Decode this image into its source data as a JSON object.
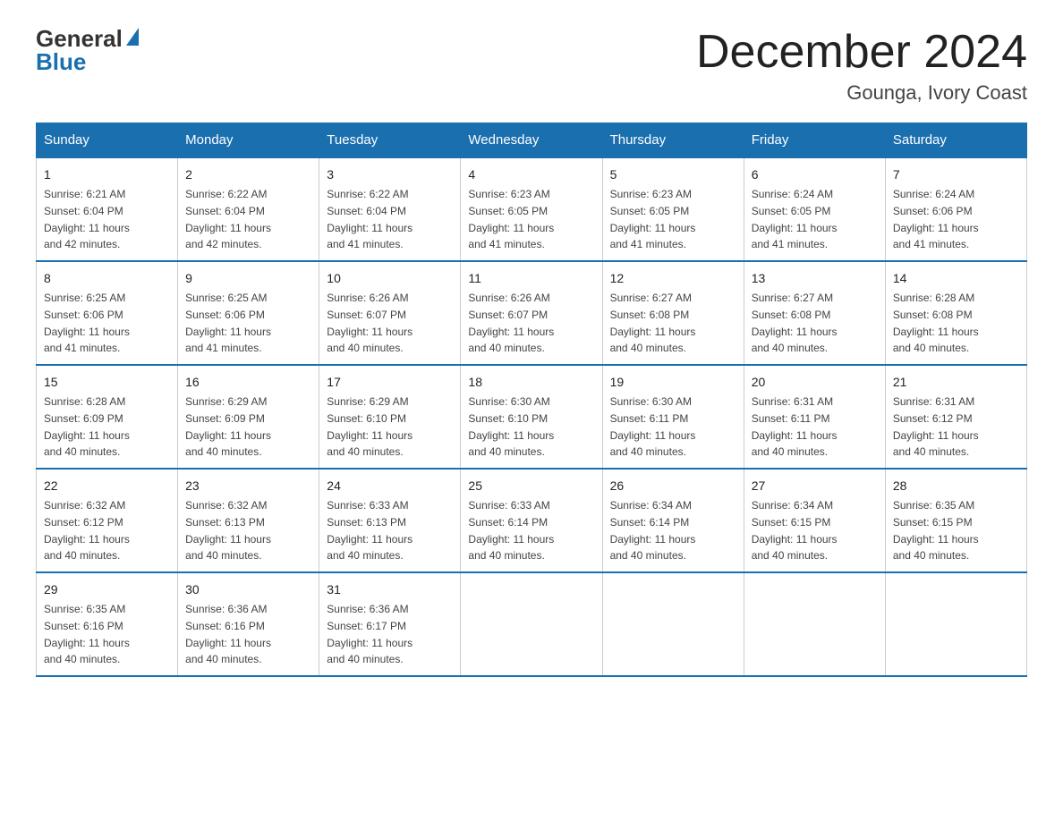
{
  "header": {
    "logo_general": "General",
    "logo_blue": "Blue",
    "month_title": "December 2024",
    "location": "Gounga, Ivory Coast"
  },
  "days_of_week": [
    "Sunday",
    "Monday",
    "Tuesday",
    "Wednesday",
    "Thursday",
    "Friday",
    "Saturday"
  ],
  "weeks": [
    [
      {
        "day": "1",
        "sunrise": "6:21 AM",
        "sunset": "6:04 PM",
        "daylight": "11 hours and 42 minutes."
      },
      {
        "day": "2",
        "sunrise": "6:22 AM",
        "sunset": "6:04 PM",
        "daylight": "11 hours and 42 minutes."
      },
      {
        "day": "3",
        "sunrise": "6:22 AM",
        "sunset": "6:04 PM",
        "daylight": "11 hours and 41 minutes."
      },
      {
        "day": "4",
        "sunrise": "6:23 AM",
        "sunset": "6:05 PM",
        "daylight": "11 hours and 41 minutes."
      },
      {
        "day": "5",
        "sunrise": "6:23 AM",
        "sunset": "6:05 PM",
        "daylight": "11 hours and 41 minutes."
      },
      {
        "day": "6",
        "sunrise": "6:24 AM",
        "sunset": "6:05 PM",
        "daylight": "11 hours and 41 minutes."
      },
      {
        "day": "7",
        "sunrise": "6:24 AM",
        "sunset": "6:06 PM",
        "daylight": "11 hours and 41 minutes."
      }
    ],
    [
      {
        "day": "8",
        "sunrise": "6:25 AM",
        "sunset": "6:06 PM",
        "daylight": "11 hours and 41 minutes."
      },
      {
        "day": "9",
        "sunrise": "6:25 AM",
        "sunset": "6:06 PM",
        "daylight": "11 hours and 41 minutes."
      },
      {
        "day": "10",
        "sunrise": "6:26 AM",
        "sunset": "6:07 PM",
        "daylight": "11 hours and 40 minutes."
      },
      {
        "day": "11",
        "sunrise": "6:26 AM",
        "sunset": "6:07 PM",
        "daylight": "11 hours and 40 minutes."
      },
      {
        "day": "12",
        "sunrise": "6:27 AM",
        "sunset": "6:08 PM",
        "daylight": "11 hours and 40 minutes."
      },
      {
        "day": "13",
        "sunrise": "6:27 AM",
        "sunset": "6:08 PM",
        "daylight": "11 hours and 40 minutes."
      },
      {
        "day": "14",
        "sunrise": "6:28 AM",
        "sunset": "6:08 PM",
        "daylight": "11 hours and 40 minutes."
      }
    ],
    [
      {
        "day": "15",
        "sunrise": "6:28 AM",
        "sunset": "6:09 PM",
        "daylight": "11 hours and 40 minutes."
      },
      {
        "day": "16",
        "sunrise": "6:29 AM",
        "sunset": "6:09 PM",
        "daylight": "11 hours and 40 minutes."
      },
      {
        "day": "17",
        "sunrise": "6:29 AM",
        "sunset": "6:10 PM",
        "daylight": "11 hours and 40 minutes."
      },
      {
        "day": "18",
        "sunrise": "6:30 AM",
        "sunset": "6:10 PM",
        "daylight": "11 hours and 40 minutes."
      },
      {
        "day": "19",
        "sunrise": "6:30 AM",
        "sunset": "6:11 PM",
        "daylight": "11 hours and 40 minutes."
      },
      {
        "day": "20",
        "sunrise": "6:31 AM",
        "sunset": "6:11 PM",
        "daylight": "11 hours and 40 minutes."
      },
      {
        "day": "21",
        "sunrise": "6:31 AM",
        "sunset": "6:12 PM",
        "daylight": "11 hours and 40 minutes."
      }
    ],
    [
      {
        "day": "22",
        "sunrise": "6:32 AM",
        "sunset": "6:12 PM",
        "daylight": "11 hours and 40 minutes."
      },
      {
        "day": "23",
        "sunrise": "6:32 AM",
        "sunset": "6:13 PM",
        "daylight": "11 hours and 40 minutes."
      },
      {
        "day": "24",
        "sunrise": "6:33 AM",
        "sunset": "6:13 PM",
        "daylight": "11 hours and 40 minutes."
      },
      {
        "day": "25",
        "sunrise": "6:33 AM",
        "sunset": "6:14 PM",
        "daylight": "11 hours and 40 minutes."
      },
      {
        "day": "26",
        "sunrise": "6:34 AM",
        "sunset": "6:14 PM",
        "daylight": "11 hours and 40 minutes."
      },
      {
        "day": "27",
        "sunrise": "6:34 AM",
        "sunset": "6:15 PM",
        "daylight": "11 hours and 40 minutes."
      },
      {
        "day": "28",
        "sunrise": "6:35 AM",
        "sunset": "6:15 PM",
        "daylight": "11 hours and 40 minutes."
      }
    ],
    [
      {
        "day": "29",
        "sunrise": "6:35 AM",
        "sunset": "6:16 PM",
        "daylight": "11 hours and 40 minutes."
      },
      {
        "day": "30",
        "sunrise": "6:36 AM",
        "sunset": "6:16 PM",
        "daylight": "11 hours and 40 minutes."
      },
      {
        "day": "31",
        "sunrise": "6:36 AM",
        "sunset": "6:17 PM",
        "daylight": "11 hours and 40 minutes."
      },
      null,
      null,
      null,
      null
    ]
  ],
  "labels": {
    "sunrise": "Sunrise:",
    "sunset": "Sunset:",
    "daylight": "Daylight:"
  }
}
